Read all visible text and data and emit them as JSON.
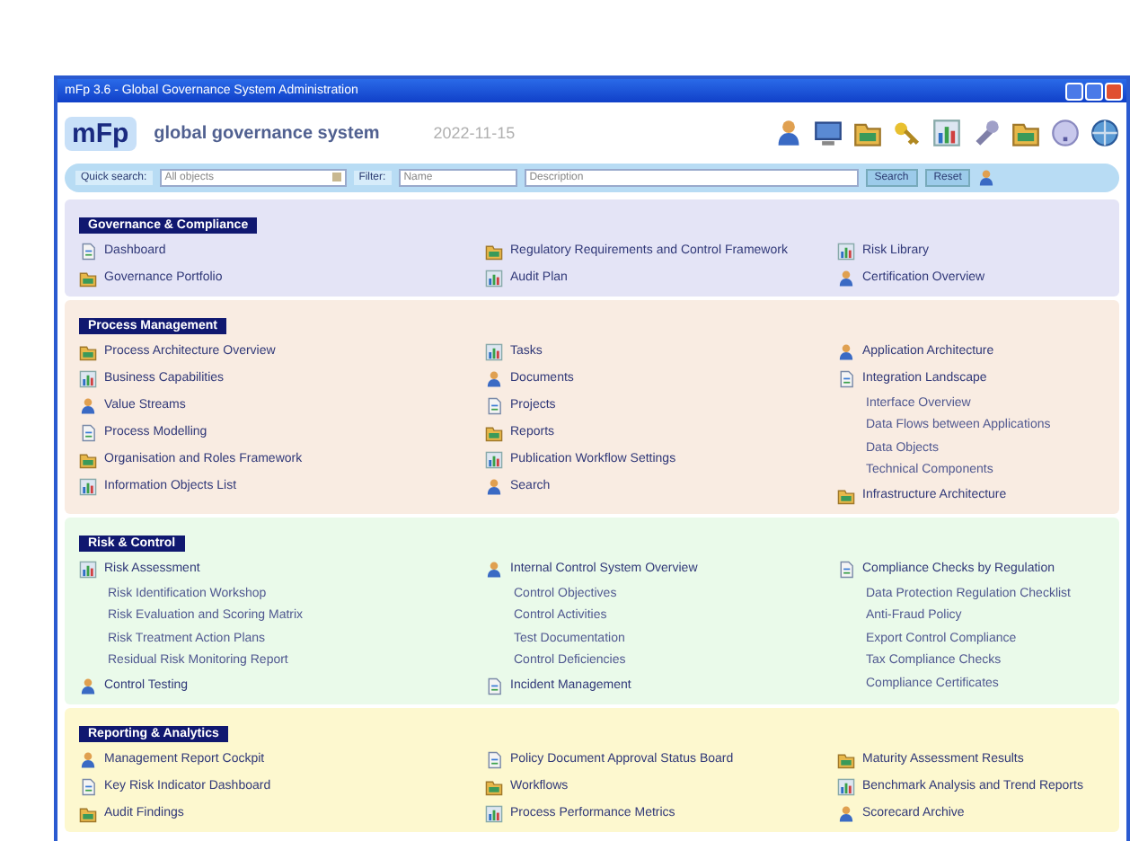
{
  "window": {
    "title": "mFp 3.6 - Global Governance System Administration"
  },
  "header": {
    "logo": "mFp",
    "subtitle": "global governance system",
    "date": "2022-11-15"
  },
  "search_bar": {
    "label": "Quick search:",
    "scope": "All objects",
    "filter_label": "Filter:",
    "name_field": "Name",
    "description_field": "Description",
    "buttons": [
      "Search",
      "Reset"
    ]
  },
  "sections": [
    {
      "title": "Governance & Compliance",
      "color": "#e4e4f6",
      "columns": [
        [
          {
            "label": "Dashboard"
          },
          {
            "label": "Governance Portfolio"
          }
        ],
        [
          {
            "label": "Regulatory Requirements and Control Framework"
          },
          {
            "label": "Audit Plan"
          }
        ],
        [
          {
            "label": "Risk Library"
          },
          {
            "label": "Certification Overview"
          }
        ]
      ]
    },
    {
      "title": "Process Management",
      "color": "#f9ece2",
      "columns": [
        [
          {
            "label": "Process Architecture Overview"
          },
          {
            "label": "Business Capabilities"
          },
          {
            "label": "Value Streams"
          },
          {
            "label": "Process Modelling"
          },
          {
            "label": "Organisation and Roles Framework"
          },
          {
            "label": "Information Objects List"
          }
        ],
        [
          {
            "label": "Tasks"
          },
          {
            "label": "Documents"
          },
          {
            "label": "Projects"
          },
          {
            "label": "Reports"
          },
          {
            "label": "Publication Workflow Settings"
          },
          {
            "label": "Search"
          }
        ],
        [
          {
            "label": "Application Architecture"
          },
          {
            "label": "Integration Landscape",
            "children": [
              {
                "label": "Interface Overview"
              },
              {
                "label": "Data Flows between Applications"
              },
              {
                "label": "Data Objects"
              },
              {
                "label": "Technical Components"
              }
            ]
          },
          {
            "label": "Infrastructure Architecture"
          }
        ]
      ]
    },
    {
      "title": "Risk & Control",
      "color": "#eafaea",
      "columns": [
        [
          {
            "label": "Risk Assessment",
            "children": [
              {
                "label": "Risk Identification Workshop"
              },
              {
                "label": "Risk Evaluation and Scoring Matrix"
              },
              {
                "label": "Risk Treatment Action Plans"
              },
              {
                "label": "Residual Risk Monitoring Report"
              }
            ]
          },
          {
            "label": "Control Testing"
          }
        ],
        [
          {
            "label": "Internal Control System Overview",
            "children": [
              {
                "label": "Control Objectives"
              },
              {
                "label": "Control Activities"
              },
              {
                "label": "Test Documentation"
              },
              {
                "label": "Control Deficiencies"
              }
            ]
          },
          {
            "label": "Incident Management"
          }
        ],
        [
          {
            "label": "Compliance Checks by Regulation",
            "children": [
              {
                "label": "Data Protection Regulation Checklist"
              },
              {
                "label": "Anti-Fraud Policy"
              },
              {
                "label": "Export Control Compliance"
              },
              {
                "label": "Tax Compliance Checks"
              },
              {
                "label": "Compliance Certificates"
              }
            ]
          }
        ]
      ]
    },
    {
      "title": "Reporting & Analytics",
      "color": "#fdf8cf",
      "columns": [
        [
          {
            "label": "Management Report Cockpit"
          },
          {
            "label": "Key Risk Indicator Dashboard"
          },
          {
            "label": "Audit Findings"
          }
        ],
        [
          {
            "label": "Policy Document Approval Status Board"
          },
          {
            "label": "Workflows"
          },
          {
            "label": "Process Performance Metrics"
          }
        ],
        [
          {
            "label": "Maturity Assessment Results"
          },
          {
            "label": "Benchmark Analysis and Trend Reports"
          },
          {
            "label": "Scorecard Archive"
          }
        ]
      ]
    }
  ]
}
